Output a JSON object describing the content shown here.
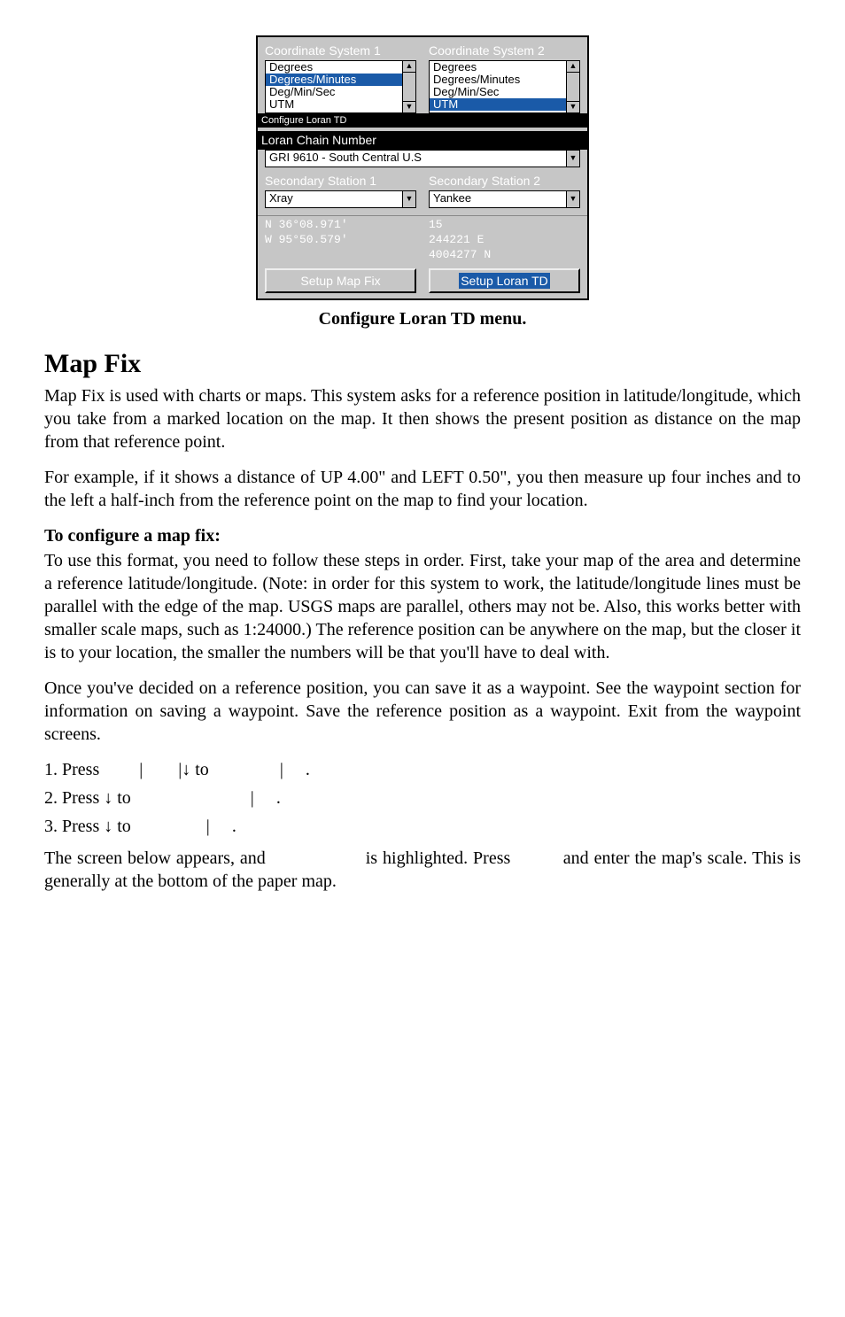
{
  "screenshot": {
    "coordSys1Label": "Coordinate System 1",
    "coordSys2Label": "Coordinate System 2",
    "list1": [
      "Degrees",
      "Degrees/Minutes",
      "Deg/Min/Sec",
      "UTM"
    ],
    "list1SelectedIndex": 1,
    "list2": [
      "Degrees",
      "Degrees/Minutes",
      "Deg/Min/Sec",
      "UTM"
    ],
    "list2SelectedIndex": 3,
    "configureBar": "Configure Loran TD",
    "loranChainLabel": "Loran Chain Number",
    "loranChainValue": "GRI 9610 - South Central U.S",
    "secStation1Label": "Secondary Station 1",
    "secStation2Label": "Secondary Station 2",
    "secStation1Value": "Xray",
    "secStation2Value": "Yankee",
    "coordLeft": [
      "N   36°08.971'",
      "W   95°50.579'"
    ],
    "coordRight": [
      "15",
      " 244221 E",
      "4004277 N"
    ],
    "btnLeft": "Setup Map Fix",
    "btnRight": "Setup Loran TD"
  },
  "caption": "Configure Loran TD menu.",
  "heading": "Map Fix",
  "para1": "Map Fix is used with charts or maps. This system asks for a reference position in latitude/longitude, which you take from a marked location on the map. It then shows the present position as distance on the map from that reference point.",
  "para2": "For example, if it shows a distance of UP 4.00\" and LEFT 0.50\", you then measure up four inches and to the left a half-inch from the reference point on the map to find your location.",
  "subhead": "To configure a map fix:",
  "para3": "To use this format, you need to follow these steps in order. First, take your map of the area and determine a reference latitude/longitude. (Note: in order for this system to work, the latitude/longitude lines must be parallel with the edge of the map. USGS maps are parallel, others may not be. Also, this works better with smaller scale maps, such as 1:24000.) The reference position can be anywhere on the map, but the closer it is to your location, the smaller the numbers will be that you'll have to deal with.",
  "para4": "Once you've decided on a reference position, you can save it as a waypoint. See the waypoint section for information on saving a waypoint. Save the reference position as a waypoint. Exit from the waypoint screens.",
  "step1a": "1. Press ",
  "step1b": "|",
  "step1c": "|↓ to ",
  "step1d": "|",
  "step1e": ".",
  "step2a": "2. Press ↓ to ",
  "step2b": "|",
  "step2c": ".",
  "step3a": "3. Press ↓ to ",
  "step3b": "|",
  "step3c": ".",
  "para5a": "The screen below appears, and ",
  "para5b": " is highlighted. Press ",
  "para5c": " and enter the map's scale. This is generally at the bottom of the paper map."
}
